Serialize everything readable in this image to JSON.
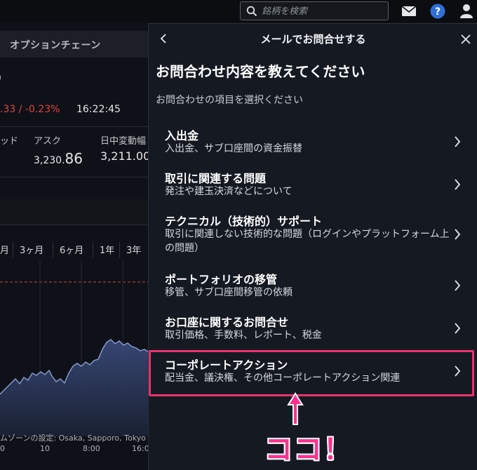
{
  "topbar": {
    "search_placeholder": "銘柄を検索",
    "icons": [
      "search-icon",
      "mail-icon",
      "help-icon",
      "user-icon"
    ]
  },
  "background": {
    "tab_label": "オプションチェーン",
    "symbol_partial": ")",
    "change": ".33 / -0.23%",
    "time": "16:22:45",
    "columns": [
      {
        "label": "ッド",
        "value": ""
      },
      {
        "label": "アスク",
        "value_prefix": "3,230.",
        "value_big": "86"
      },
      {
        "label": "日中変動幅",
        "value": "3,211.00"
      }
    ],
    "periods": [
      "月",
      "3ヶ月",
      "6ヶ月",
      "1年",
      "3年"
    ],
    "tz_note": "ムゾーンの設定: Osaka, Sapporo, Tokyo",
    "x_ticks": [
      "0",
      "10",
      "8:00",
      "16:0"
    ],
    "colors": {
      "down": "#e0443e",
      "dashed_line": "#e0443e",
      "series": "#7d93c9"
    }
  },
  "modal": {
    "title": "メールでお問合せする",
    "heading": "お問合わせ内容を教えてください",
    "subheading": "お問合わせの項目を選択ください",
    "items": [
      {
        "title": "入出金",
        "desc": "入出金、サブ口座間の資金振替"
      },
      {
        "title": "取引に関連する問題",
        "desc": "発注や建玉決済などについて"
      },
      {
        "title": "テクニカル（技術的）サポート",
        "desc": "取引に関連しない技術的な問題（ログインやプラットフォーム上の問題）"
      },
      {
        "title": "ポートフォリオの移管",
        "desc": "移管、サブ口座間移管の依頼"
      },
      {
        "title": "お口座に関するお問合せ",
        "desc": "取引価格、手数料、レポート、税金"
      },
      {
        "title": "コーポレートアクション",
        "desc": "配当金、議決権、その他コーポレートアクション関連"
      }
    ],
    "annotation": "ココ！",
    "accent": "#e8336d"
  }
}
